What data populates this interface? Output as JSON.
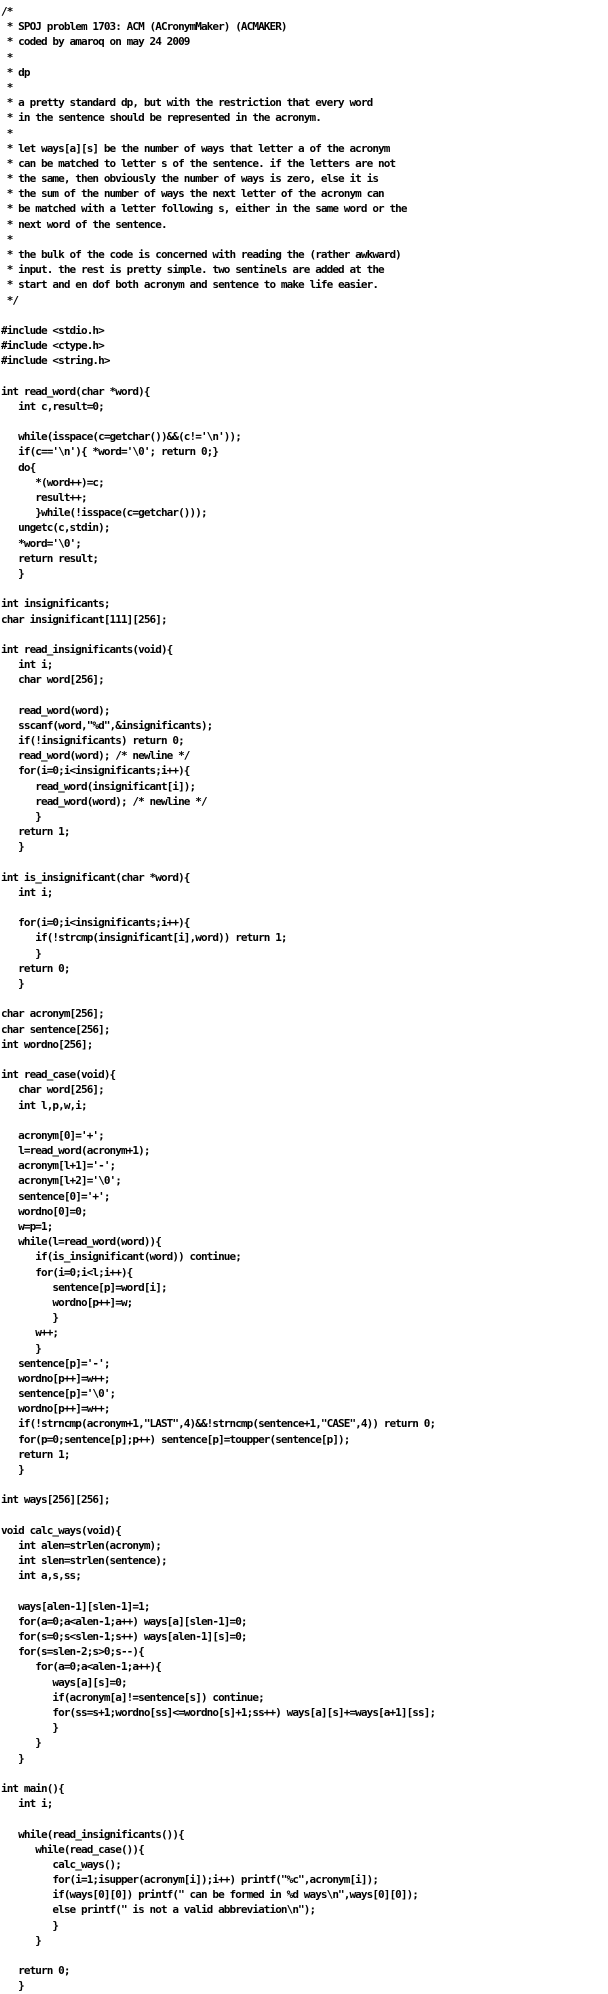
{
  "document": {
    "lines": [
      "/*",
      " * SPOJ problem 1703: ACM (ACronymMaker) (ACMAKER)",
      " * coded by amaroq on may 24 2009",
      " *",
      " * dp",
      " *",
      " * a pretty standard dp, but with the restriction that every word",
      " * in the sentence should be represented in the acronym.",
      " *",
      " * let ways[a][s] be the number of ways that letter a of the acronym",
      " * can be matched to letter s of the sentence. if the letters are not",
      " * the same, then obviously the number of ways is zero, else it is",
      " * the sum of the number of ways the next letter of the acronym can",
      " * be matched with a letter following s, either in the same word or the",
      " * next word of the sentence.",
      " *",
      " * the bulk of the code is concerned with reading the (rather awkward)",
      " * input. the rest is pretty simple. two sentinels are added at the",
      " * start and en dof both acronym and sentence to make life easier.",
      " */",
      "",
      "#include <stdio.h>",
      "#include <ctype.h>",
      "#include <string.h>",
      "",
      "int read_word(char *word){",
      "   int c,result=0;",
      "",
      "   while(isspace(c=getchar())&&(c!='\\n'));",
      "   if(c=='\\n'){ *word='\\0'; return 0;}",
      "   do{",
      "      *(word++)=c;",
      "      result++;",
      "      }while(!isspace(c=getchar()));",
      "   ungetc(c,stdin);",
      "   *word='\\0';",
      "   return result;",
      "   }",
      "",
      "int insignificants;",
      "char insignificant[111][256];",
      "",
      "int read_insignificants(void){",
      "   int i;",
      "   char word[256];",
      "",
      "   read_word(word);",
      "   sscanf(word,\"%d\",&insignificants);",
      "   if(!insignificants) return 0;",
      "   read_word(word); /* newline */",
      "   for(i=0;i<insignificants;i++){",
      "      read_word(insignificant[i]);",
      "      read_word(word); /* newline */",
      "      }",
      "   return 1;",
      "   }",
      "",
      "int is_insignificant(char *word){",
      "   int i;",
      "",
      "   for(i=0;i<insignificants;i++){",
      "      if(!strcmp(insignificant[i],word)) return 1;",
      "      }",
      "   return 0;",
      "   }",
      "",
      "char acronym[256];",
      "char sentence[256];",
      "int wordno[256];",
      "",
      "int read_case(void){",
      "   char word[256];",
      "   int l,p,w,i;",
      "",
      "   acronym[0]='+';",
      "   l=read_word(acronym+1);",
      "   acronym[l+1]='-';",
      "   acronym[l+2]='\\0';",
      "   sentence[0]='+';",
      "   wordno[0]=0;",
      "   w=p=1;",
      "   while(l=read_word(word)){",
      "      if(is_insignificant(word)) continue;",
      "      for(i=0;i<l;i++){",
      "         sentence[p]=word[i];",
      "         wordno[p++]=w;",
      "         }",
      "      w++;",
      "      }",
      "   sentence[p]='-';",
      "   wordno[p++]=w++;",
      "   sentence[p]='\\0';",
      "   wordno[p++]=w++;",
      "   if(!strncmp(acronym+1,\"LAST\",4)&&!strncmp(sentence+1,\"CASE\",4)) return 0;",
      "   for(p=0;sentence[p];p++) sentence[p]=toupper(sentence[p]);",
      "   return 1;",
      "   }",
      "",
      "int ways[256][256];",
      "",
      "void calc_ways(void){",
      "   int alen=strlen(acronym);",
      "   int slen=strlen(sentence);",
      "   int a,s,ss;",
      "",
      "   ways[alen-1][slen-1]=1;",
      "   for(a=0;a<alen-1;a++) ways[a][slen-1]=0;",
      "   for(s=0;s<slen-1;s++) ways[alen-1][s]=0;",
      "   for(s=slen-2;s>0;s--){",
      "      for(a=0;a<alen-1;a++){",
      "         ways[a][s]=0;",
      "         if(acronym[a]!=sentence[s]) continue;",
      "         for(ss=s+1;wordno[ss]<=wordno[s]+1;ss++) ways[a][s]+=ways[a+1][ss];",
      "         }",
      "      }",
      "   }",
      "",
      "int main(){",
      "   int i;",
      "",
      "   while(read_insignificants()){",
      "      while(read_case()){",
      "         calc_ways();",
      "         for(i=1;isupper(acronym[i]);i++) printf(\"%c\",acronym[i]);",
      "         if(ways[0][0]) printf(\" can be formed in %d ways\\n\",ways[0][0]);",
      "         else printf(\" is not a valid abbreviation\\n\");",
      "         }",
      "      }",
      "",
      "   return 0;",
      "   }"
    ]
  }
}
